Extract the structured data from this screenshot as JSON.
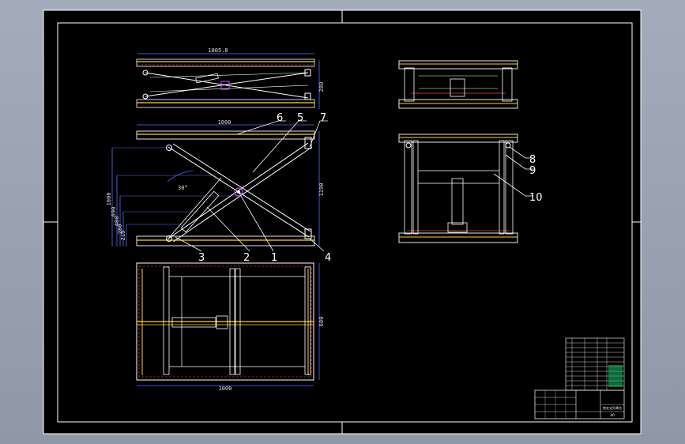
{
  "colors": {
    "background": "#9aa3b2",
    "paper": "#000000",
    "frame": "#ffffff",
    "outline": "#ffffff",
    "dimension": "#5a6cff",
    "centerline": "#ffd21f",
    "hidden": "#ff3c3c",
    "leader": "#ffffff",
    "table_green": "#19c16b"
  },
  "side_view": {
    "dim_length": "1005.8",
    "dim_height": "280"
  },
  "front_view": {
    "dim_length": "1000",
    "dim_height": "1190",
    "dim_heights": [
      "1000",
      "690",
      "480",
      "280",
      "219"
    ],
    "dim_angle": "30°"
  },
  "plan_view": {
    "dim_length": "1000",
    "dim_width": "600"
  },
  "callouts": [
    "1",
    "2",
    "3",
    "4",
    "5",
    "6",
    "7",
    "8",
    "9",
    "10"
  ],
  "title_block": {
    "drawing_title": "剪叉式升降台",
    "sheet_size": "A0"
  }
}
